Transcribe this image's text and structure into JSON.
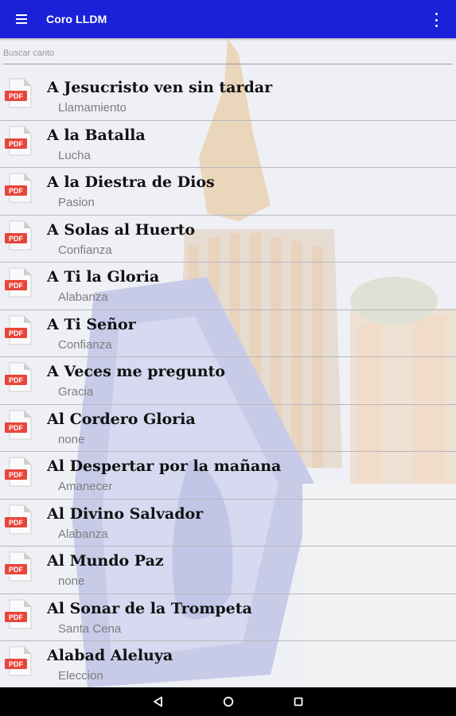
{
  "app": {
    "title": "Coro LLDM"
  },
  "search": {
    "placeholder": "Buscar canto",
    "value": ""
  },
  "file_badge": "PDF",
  "songs": [
    {
      "title": "A Jesucristo ven sin tardar",
      "category": "Llamamiento"
    },
    {
      "title": "A la Batalla",
      "category": "Lucha"
    },
    {
      "title": "A la Diestra de Dios",
      "category": "Pasion"
    },
    {
      "title": "A Solas al Huerto",
      "category": "Confianza"
    },
    {
      "title": "A Ti la Gloria",
      "category": "Alabanza"
    },
    {
      "title": "A Ti Señor",
      "category": "Confianza"
    },
    {
      "title": "A Veces me pregunto",
      "category": "Gracia"
    },
    {
      "title": "Al Cordero Gloria",
      "category": "none"
    },
    {
      "title": "Al Despertar por la mañana",
      "category": "Amanecer"
    },
    {
      "title": "Al Divino Salvador",
      "category": "Alabanza"
    },
    {
      "title": "Al Mundo Paz",
      "category": "none"
    },
    {
      "title": "Al Sonar de la Trompeta",
      "category": "Santa Cena"
    },
    {
      "title": "Alabad Aleluya",
      "category": "Eleccion"
    }
  ],
  "colors": {
    "appbar": "#1a21d8",
    "pdf_red": "#e8453a",
    "navbar": "#000000"
  },
  "icons": {
    "menu": "hamburger-icon",
    "overflow": "more-vert-icon",
    "nav": [
      "back-triangle-icon",
      "home-circle-icon",
      "recents-square-icon"
    ]
  }
}
